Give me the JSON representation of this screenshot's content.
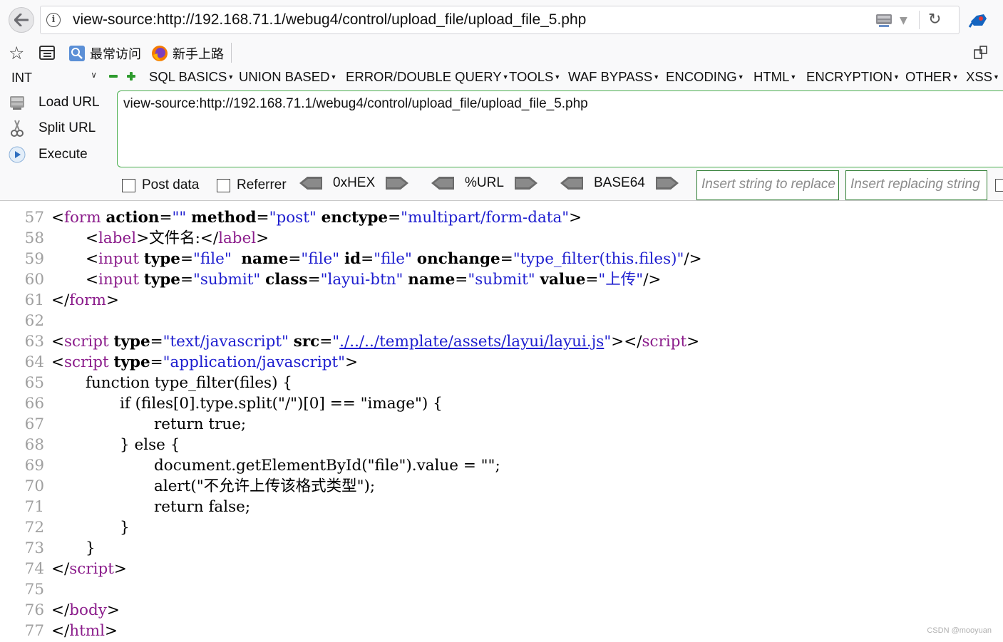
{
  "browser": {
    "url": "view-source:http://192.168.71.1/webug4/control/upload_file/upload_file_5.php",
    "bookmarks": [
      {
        "label": "最常访问",
        "icon": "most-visited-icon"
      },
      {
        "label": "新手上路",
        "icon": "firefox-icon"
      }
    ]
  },
  "hackbar": {
    "int_select": "INT",
    "menu": [
      "SQL BASICS",
      "UNION BASED",
      "ERROR/DOUBLE QUERY",
      "TOOLS",
      "WAF BYPASS",
      "ENCODING",
      "HTML",
      "ENCRYPTION",
      "OTHER",
      "XSS"
    ],
    "load_url": "Load URL",
    "split_url": "Split URL",
    "execute": "Execute",
    "url_value": "view-source:http://192.168.71.1/webug4/control/upload_file/upload_file_5.php",
    "post_data": "Post data",
    "referrer": "Referrer",
    "hex": "0xHEX",
    "urlenc": "%URL",
    "base64": "BASE64",
    "replace_placeholder": "Insert string to replace",
    "replacing_placeholder": "Insert replacing string"
  },
  "source": {
    "lines": [
      {
        "n": "57",
        "indent": 0,
        "tokens": [
          [
            "br",
            "<"
          ],
          [
            "tag",
            "form"
          ],
          [
            "p",
            " "
          ],
          [
            "attr",
            "action"
          ],
          [
            "p",
            "="
          ],
          [
            "val",
            "\"\""
          ],
          [
            "p",
            " "
          ],
          [
            "attr",
            "method"
          ],
          [
            "p",
            "="
          ],
          [
            "val",
            "\"post\""
          ],
          [
            "p",
            " "
          ],
          [
            "attr",
            "enctype"
          ],
          [
            "p",
            "="
          ],
          [
            "val",
            "\"multipart/form-data\""
          ],
          [
            "br",
            ">"
          ]
        ]
      },
      {
        "n": "58",
        "indent": 1,
        "tokens": [
          [
            "br",
            "<"
          ],
          [
            "tag",
            "label"
          ],
          [
            "br",
            ">"
          ],
          [
            "p",
            "文件名:"
          ],
          [
            "br",
            "</"
          ],
          [
            "tag",
            "label"
          ],
          [
            "br",
            ">"
          ]
        ]
      },
      {
        "n": "59",
        "indent": 1,
        "tokens": [
          [
            "br",
            "<"
          ],
          [
            "tag",
            "input"
          ],
          [
            "p",
            " "
          ],
          [
            "attr",
            "type"
          ],
          [
            "p",
            "="
          ],
          [
            "val",
            "\"file\""
          ],
          [
            "p",
            "  "
          ],
          [
            "attr",
            "name"
          ],
          [
            "p",
            "="
          ],
          [
            "val",
            "\"file\""
          ],
          [
            "p",
            " "
          ],
          [
            "attr",
            "id"
          ],
          [
            "p",
            "="
          ],
          [
            "val",
            "\"file\""
          ],
          [
            "p",
            " "
          ],
          [
            "attr",
            "onchange"
          ],
          [
            "p",
            "="
          ],
          [
            "val",
            "\"type_filter(this.files)\""
          ],
          [
            "br",
            "/>"
          ]
        ]
      },
      {
        "n": "60",
        "indent": 1,
        "tokens": [
          [
            "br",
            "<"
          ],
          [
            "tag",
            "input"
          ],
          [
            "p",
            " "
          ],
          [
            "attr",
            "type"
          ],
          [
            "p",
            "="
          ],
          [
            "val",
            "\"submit\""
          ],
          [
            "p",
            " "
          ],
          [
            "attr",
            "class"
          ],
          [
            "p",
            "="
          ],
          [
            "val",
            "\"layui-btn\""
          ],
          [
            "p",
            " "
          ],
          [
            "attr",
            "name"
          ],
          [
            "p",
            "="
          ],
          [
            "val",
            "\"submit\""
          ],
          [
            "p",
            " "
          ],
          [
            "attr",
            "value"
          ],
          [
            "p",
            "="
          ],
          [
            "val",
            "\"上传\""
          ],
          [
            "br",
            "/>"
          ]
        ]
      },
      {
        "n": "61",
        "indent": 0,
        "tokens": [
          [
            "br",
            "</"
          ],
          [
            "tag",
            "form"
          ],
          [
            "br",
            ">"
          ]
        ]
      },
      {
        "n": "62",
        "indent": 0,
        "tokens": []
      },
      {
        "n": "63",
        "indent": 0,
        "tokens": [
          [
            "br",
            "<"
          ],
          [
            "tag",
            "script"
          ],
          [
            "p",
            " "
          ],
          [
            "attr",
            "type"
          ],
          [
            "p",
            "="
          ],
          [
            "val",
            "\"text/javascript\""
          ],
          [
            "p",
            " "
          ],
          [
            "attr",
            "src"
          ],
          [
            "p",
            "="
          ],
          [
            "val",
            "\""
          ],
          [
            "link",
            "./../../template/assets/layui/layui.js"
          ],
          [
            "val",
            "\""
          ],
          [
            "br",
            "></"
          ],
          [
            "tag",
            "script"
          ],
          [
            "br",
            ">"
          ]
        ]
      },
      {
        "n": "64",
        "indent": 0,
        "tokens": [
          [
            "br",
            "<"
          ],
          [
            "tag",
            "script"
          ],
          [
            "p",
            " "
          ],
          [
            "attr",
            "type"
          ],
          [
            "p",
            "="
          ],
          [
            "val",
            "\"application/javascript\""
          ],
          [
            "br",
            ">"
          ]
        ]
      },
      {
        "n": "65",
        "indent": 1,
        "tokens": [
          [
            "p",
            "function type_filter(files) {"
          ]
        ]
      },
      {
        "n": "66",
        "indent": 2,
        "tokens": [
          [
            "p",
            "if (files[0].type.split(\"/\")[0] == \"image\") {"
          ]
        ]
      },
      {
        "n": "67",
        "indent": 3,
        "tokens": [
          [
            "p",
            "return true;"
          ]
        ]
      },
      {
        "n": "68",
        "indent": 2,
        "tokens": [
          [
            "p",
            "} else {"
          ]
        ]
      },
      {
        "n": "69",
        "indent": 3,
        "tokens": [
          [
            "p",
            "document.getElementById(\"file\").value = \"\";"
          ]
        ]
      },
      {
        "n": "70",
        "indent": 3,
        "tokens": [
          [
            "p",
            "alert(\"不允许上传该格式类型\");"
          ]
        ]
      },
      {
        "n": "71",
        "indent": 3,
        "tokens": [
          [
            "p",
            "return false;"
          ]
        ]
      },
      {
        "n": "72",
        "indent": 2,
        "tokens": [
          [
            "p",
            "}"
          ]
        ]
      },
      {
        "n": "73",
        "indent": 1,
        "tokens": [
          [
            "p",
            "}"
          ]
        ]
      },
      {
        "n": "74",
        "indent": 0,
        "tokens": [
          [
            "br",
            "</"
          ],
          [
            "tag",
            "script"
          ],
          [
            "br",
            ">"
          ]
        ]
      },
      {
        "n": "75",
        "indent": 0,
        "tokens": []
      },
      {
        "n": "76",
        "indent": 0,
        "tokens": [
          [
            "br",
            "</"
          ],
          [
            "tag",
            "body"
          ],
          [
            "br",
            ">"
          ]
        ]
      },
      {
        "n": "77",
        "indent": 0,
        "tokens": [
          [
            "br",
            "</"
          ],
          [
            "tag",
            "html"
          ],
          [
            "br",
            ">"
          ]
        ]
      }
    ]
  },
  "watermark": "CSDN @mooyuan"
}
